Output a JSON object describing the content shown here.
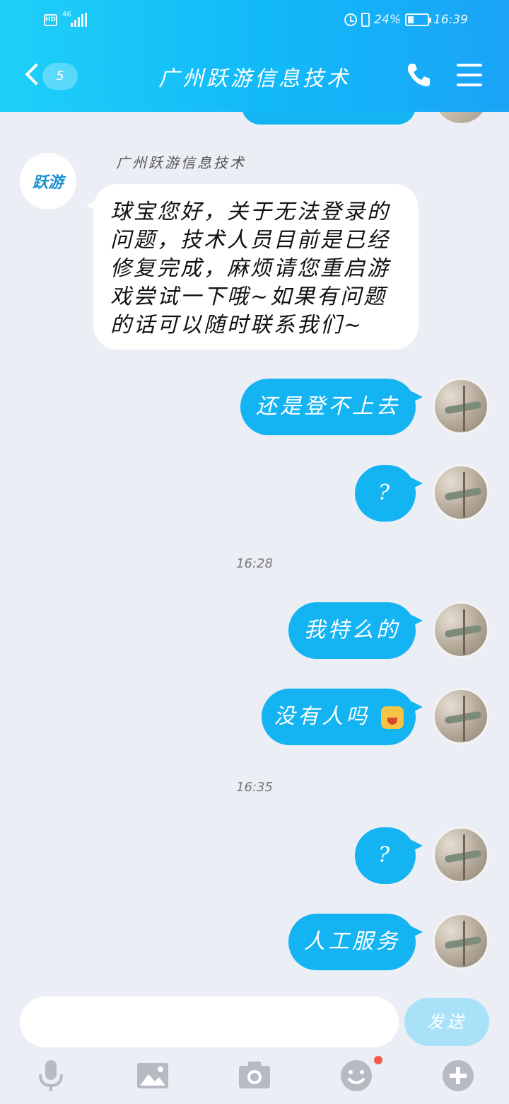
{
  "status_bar": {
    "hd_label": "HD",
    "network": "46",
    "battery": "24%",
    "time": "16:39"
  },
  "header": {
    "unread_count": "5",
    "title": "广州跃游信息技术"
  },
  "bot": {
    "sender_name": "广州跃游信息技术",
    "logo_text": "跃游",
    "message": "球宝您好，关于无法登录的问题，技术人员目前是已经修复完成，麻烦请您重启游戏尝试一下哦~如果有问题的话可以随时联系我们~"
  },
  "messages": [
    {
      "text": "还是登不上去"
    },
    {
      "text": "?"
    },
    {
      "text": "我特么的"
    },
    {
      "text": "没有人吗"
    },
    {
      "text": "?"
    },
    {
      "text": "人工服务"
    }
  ],
  "timestamps": [
    "16:28",
    "16:35"
  ],
  "input": {
    "send_label": "发送",
    "value": ""
  },
  "toolbar": {
    "icons": [
      "microphone-icon",
      "image-icon",
      "camera-icon",
      "emoji-icon",
      "plus-icon"
    ]
  },
  "colors": {
    "header_gradient_start": "#1ed0f8",
    "header_gradient_end": "#1aa4f6",
    "outgoing_bubble": "#14b3f2",
    "send_button": "#a9e2f8",
    "notification_dot": "#f45a4a"
  }
}
